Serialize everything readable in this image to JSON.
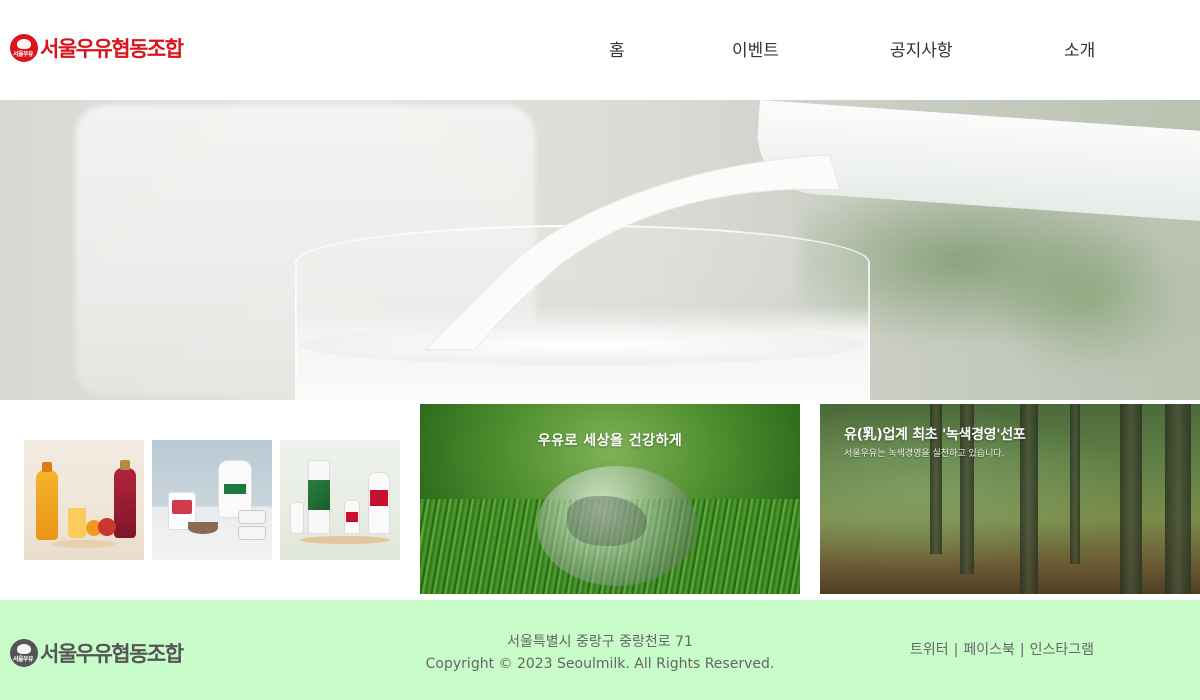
{
  "brand": {
    "name": "서울우유협동조합",
    "mark_text": "서울우유"
  },
  "nav": {
    "items": [
      {
        "label": "홈"
      },
      {
        "label": "이벤트"
      },
      {
        "label": "공지사항"
      },
      {
        "label": "소개"
      }
    ]
  },
  "hero": {
    "image": "milk-pouring-into-glass"
  },
  "products": [
    {
      "image": "juice-bottles-with-fruit"
    },
    {
      "image": "milk-jug-and-yogurt"
    },
    {
      "image": "a2-milk-cartons"
    }
  ],
  "banners": {
    "earth": {
      "caption": "우유로 세상을 건강하게",
      "image": "glass-globe-on-grass"
    },
    "forest": {
      "title": "유(乳)업계 최초 '녹색경영'선포",
      "subtitle": "서울우유는 녹색경영을 실천하고 있습니다.",
      "image": "forest"
    }
  },
  "footer": {
    "address": "서울특별시 중랑구 중랑천로 71",
    "copyright": "Copyright © 2023 Seoulmilk. All Rights Reserved.",
    "social": [
      {
        "label": "트위터"
      },
      {
        "label": "페이스북"
      },
      {
        "label": "인스타그램"
      }
    ],
    "separator": "|"
  },
  "colors": {
    "brand_red": "#d9141b",
    "footer_bg": "#c8fcc8",
    "footer_text": "#666666"
  }
}
